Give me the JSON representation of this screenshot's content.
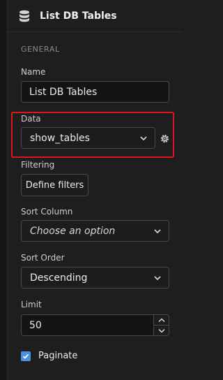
{
  "header": {
    "title": "List DB Tables",
    "icon": "database-icon"
  },
  "section": {
    "label": "GENERAL"
  },
  "name": {
    "label": "Name",
    "value": "List DB Tables"
  },
  "data": {
    "label": "Data",
    "value": "show_tables",
    "settings_icon": "gear-icon"
  },
  "filtering": {
    "label": "Filtering",
    "button": "Define filters"
  },
  "sort_column": {
    "label": "Sort Column",
    "placeholder": "Choose an option"
  },
  "sort_order": {
    "label": "Sort Order",
    "value": "Descending"
  },
  "limit": {
    "label": "Limit",
    "value": "50"
  },
  "paginate": {
    "label": "Paginate",
    "checked": true
  },
  "colors": {
    "highlight": "#e0161e",
    "checkbox": "#4b90e2"
  }
}
